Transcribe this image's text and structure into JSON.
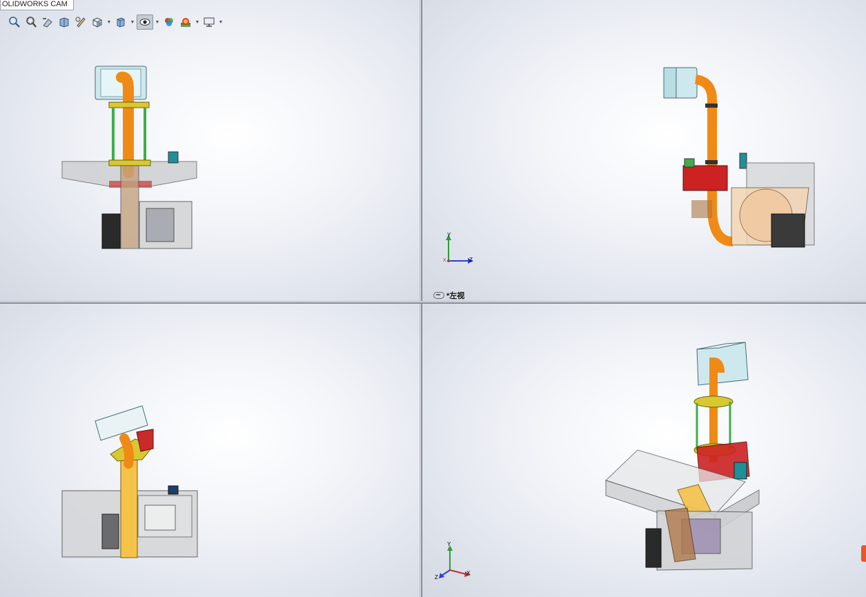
{
  "app": {
    "tab_label": "OLIDWORKS CAM"
  },
  "toolbar": {
    "items": [
      {
        "name": "zoom-to-fit-icon"
      },
      {
        "name": "zoom-to-area-icon"
      },
      {
        "name": "previous-view-icon"
      },
      {
        "name": "section-view-icon"
      },
      {
        "name": "dynamic-annotation-icon"
      },
      {
        "name": "view-orientation-icon"
      },
      {
        "name": "display-style-icon"
      },
      {
        "name": "hide-show-items-icon"
      },
      {
        "name": "edit-appearance-icon"
      },
      {
        "name": "apply-scene-icon"
      },
      {
        "name": "view-settings-icon"
      }
    ]
  },
  "viewports": {
    "top_right": {
      "label": "*左视"
    }
  },
  "triad": {
    "x": "X",
    "y": "Y",
    "z": "Z"
  },
  "colors": {
    "pipe_orange": "#f08a16",
    "frame_yellow": "#d9c830",
    "rod_green": "#3fae47",
    "body_red": "#cc2222",
    "cap_cyan": "#cde9ee",
    "glass_gray": "#c8cacd"
  }
}
